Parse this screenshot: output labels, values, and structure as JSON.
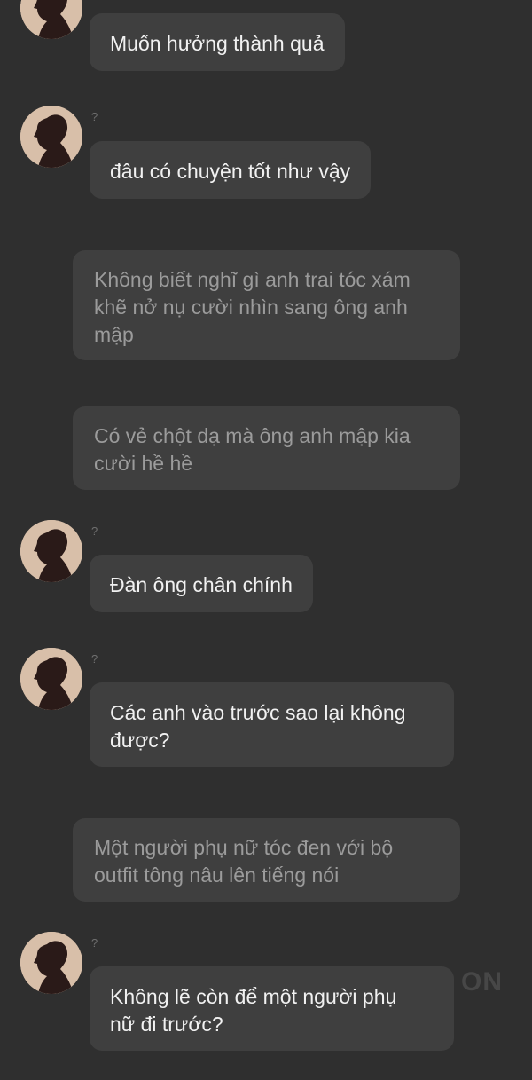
{
  "watermark": "ON",
  "messages": [
    {
      "kind": "dialog",
      "avatar": "silhouette-avatar",
      "sender": "",
      "text": "Muốn hưởng thành quả"
    },
    {
      "kind": "dialog",
      "avatar": "silhouette-avatar",
      "sender": "?",
      "text": "đâu có chuyện tốt như vậy"
    },
    {
      "kind": "narration",
      "text": "Không biết nghĩ gì anh trai tóc xám\nkhẽ nở nụ cười nhìn sang ông anh\nmập"
    },
    {
      "kind": "narration",
      "text": "Có vẻ chột dạ mà ông anh mập kia\ncười hề hề"
    },
    {
      "kind": "dialog",
      "avatar": "silhouette-avatar",
      "sender": "?",
      "text": "Đàn ông chân chính"
    },
    {
      "kind": "dialog",
      "avatar": "silhouette-avatar",
      "sender": "?",
      "text": "Các anh vào trước sao lại không\nđược?"
    },
    {
      "kind": "narration",
      "text": "Một người phụ nữ tóc đen với bộ\noutfit tông nâu lên tiếng nói"
    },
    {
      "kind": "dialog",
      "avatar": "silhouette-avatar",
      "sender": "?",
      "text": "Không lẽ còn để một người phụ\nnữ đi trước?"
    }
  ]
}
